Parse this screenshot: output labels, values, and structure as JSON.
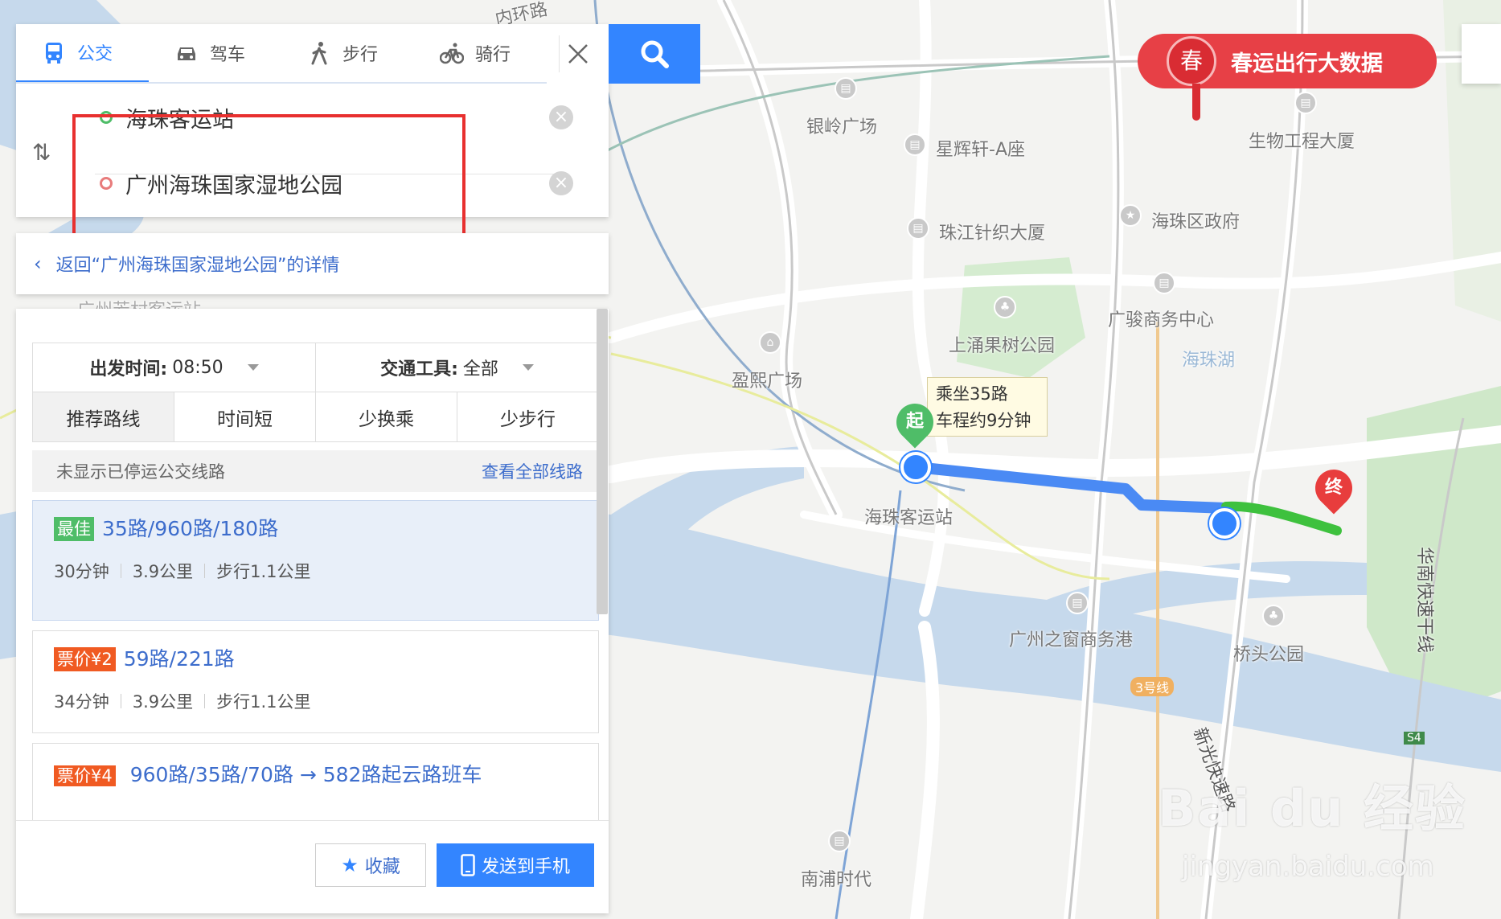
{
  "colors": {
    "accent": "#3385ff",
    "best": "#4fbd68",
    "price": "#f05a22",
    "highlight": "#e8302f",
    "route_bus": "#4a8af4",
    "route_walk": "#3ec13e"
  },
  "modes": [
    {
      "label": "公交",
      "icon": "bus-icon",
      "active": true
    },
    {
      "label": "驾车",
      "icon": "car-icon"
    },
    {
      "label": "步行",
      "icon": "walk-icon"
    },
    {
      "label": "骑行",
      "icon": "bike-icon"
    }
  ],
  "route": {
    "from": "海珠客运站",
    "to": "广州海珠国家湿地公园"
  },
  "back_link": "返回“广州海珠国家湿地公园”的详情",
  "filters": {
    "depart_label": "出发时间:",
    "depart_value": "08:50",
    "tool_label": "交通工具:",
    "tool_value": "全部"
  },
  "sort_tabs": [
    "推荐路线",
    "时间短",
    "少换乘",
    "少步行"
  ],
  "notice": {
    "text": "未显示已停运公交线路",
    "link": "查看全部线路"
  },
  "routes": [
    {
      "badge": "最佳",
      "title": "35路/960路/180路",
      "time": "30分钟",
      "distance": "3.9公里",
      "walk": "步行1.1公里"
    },
    {
      "badge": "票价¥2",
      "title": "59路/221路",
      "time": "34分钟",
      "distance": "3.9公里",
      "walk": "步行1.1公里"
    },
    {
      "badge": "票价¥4",
      "title": "960路/35路/70路 → 582路起云路班车"
    }
  ],
  "footer": {
    "favorite": "收藏",
    "send": "发送到手机"
  },
  "promo": {
    "badge": "春",
    "text": "春运出行大数据"
  },
  "map": {
    "tooltip_line1": "乘坐35路",
    "tooltip_line2": "车程约9分钟",
    "start_label": "起",
    "end_label": "终",
    "labels": [
      "内环路",
      "银岭广场",
      "星辉轩-A座",
      "珠江针织大厦",
      "海珠区政府",
      "生物工程大厦",
      "广骏商务中心",
      "上涌果树公园",
      "海珠湖",
      "盈熙广场",
      "广州芳村客运站",
      "海珠客运站",
      "广州之窗商务港",
      "桥头公园",
      "3号线",
      "南浦时代",
      "S4",
      "华南快速干线",
      "新光快速路"
    ]
  },
  "watermark": {
    "main": "Bai du 经验",
    "sub": "jingyan.baidu.com"
  }
}
